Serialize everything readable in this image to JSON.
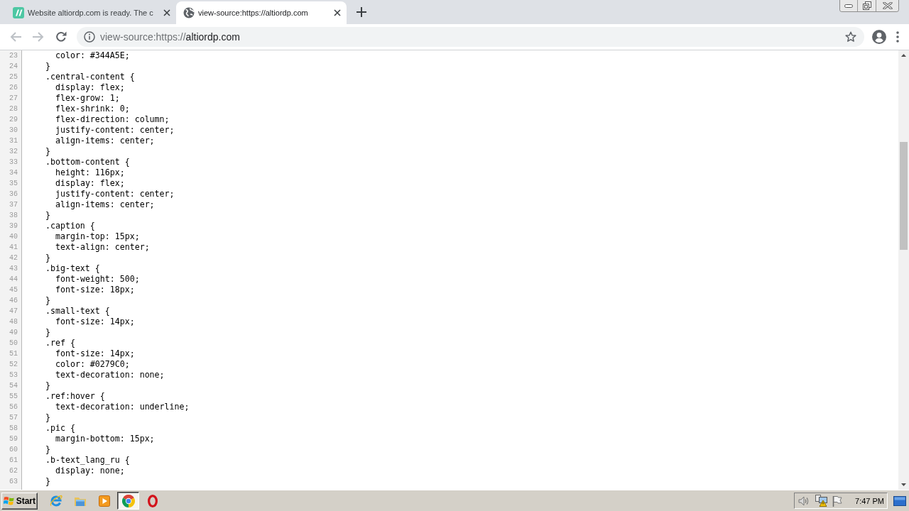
{
  "tabs": [
    {
      "kind": "logo",
      "title": "Website altiordp.com is ready. The c",
      "selected": false
    },
    {
      "kind": "globe",
      "title": "view-source:https://altiordp.com",
      "selected": true
    }
  ],
  "toolbar": {
    "nav_buttons": [
      {
        "kind": "back",
        "disabled": true
      },
      {
        "kind": "forward",
        "disabled": true
      },
      {
        "kind": "reload",
        "disabled": false
      }
    ],
    "address": {
      "scheme": "view-source:https://",
      "host": "altiordp.com"
    }
  },
  "source": {
    "lines": [
      {
        "number": "23",
        "kind": "declaration",
        "text": "color: #344A5E;"
      },
      {
        "number": "24",
        "kind": "brace",
        "text": "}"
      },
      {
        "number": "25",
        "kind": "selector",
        "text": ".central-content {"
      },
      {
        "number": "26",
        "kind": "declaration",
        "text": "display: flex;"
      },
      {
        "number": "27",
        "kind": "declaration",
        "text": "flex-grow: 1;"
      },
      {
        "number": "28",
        "kind": "declaration",
        "text": "flex-shrink: 0;"
      },
      {
        "number": "29",
        "kind": "declaration",
        "text": "flex-direction: column;"
      },
      {
        "number": "30",
        "kind": "declaration",
        "text": "justify-content: center;"
      },
      {
        "number": "31",
        "kind": "declaration",
        "text": "align-items: center;"
      },
      {
        "number": "32",
        "kind": "brace",
        "text": "}"
      },
      {
        "number": "33",
        "kind": "selector",
        "text": ".bottom-content {"
      },
      {
        "number": "34",
        "kind": "declaration",
        "text": "height: 116px;"
      },
      {
        "number": "35",
        "kind": "declaration",
        "text": "display: flex;"
      },
      {
        "number": "36",
        "kind": "declaration",
        "text": "justify-content: center;"
      },
      {
        "number": "37",
        "kind": "declaration",
        "text": "align-items: center;"
      },
      {
        "number": "38",
        "kind": "brace",
        "text": "}"
      },
      {
        "number": "39",
        "kind": "selector",
        "text": ".caption {"
      },
      {
        "number": "40",
        "kind": "declaration",
        "text": "margin-top: 15px;"
      },
      {
        "number": "41",
        "kind": "declaration",
        "text": "text-align: center;"
      },
      {
        "number": "42",
        "kind": "brace",
        "text": "}"
      },
      {
        "number": "43",
        "kind": "selector",
        "text": ".big-text {"
      },
      {
        "number": "44",
        "kind": "declaration",
        "text": "font-weight: 500;"
      },
      {
        "number": "45",
        "kind": "declaration",
        "text": "font-size: 18px;"
      },
      {
        "number": "46",
        "kind": "brace",
        "text": "}"
      },
      {
        "number": "47",
        "kind": "selector",
        "text": ".small-text {"
      },
      {
        "number": "48",
        "kind": "declaration",
        "text": "font-size: 14px;"
      },
      {
        "number": "49",
        "kind": "brace",
        "text": "}"
      },
      {
        "number": "50",
        "kind": "selector",
        "text": ".ref {"
      },
      {
        "number": "51",
        "kind": "declaration",
        "text": "font-size: 14px;"
      },
      {
        "number": "52",
        "kind": "declaration",
        "text": "color: #0279C0;"
      },
      {
        "number": "53",
        "kind": "declaration",
        "text": "text-decoration: none;"
      },
      {
        "number": "54",
        "kind": "brace",
        "text": "}"
      },
      {
        "number": "55",
        "kind": "selector",
        "text": ".ref:hover {"
      },
      {
        "number": "56",
        "kind": "declaration",
        "text": "text-decoration: underline;"
      },
      {
        "number": "57",
        "kind": "brace",
        "text": "}"
      },
      {
        "number": "58",
        "kind": "selector",
        "text": ".pic {"
      },
      {
        "number": "59",
        "kind": "declaration",
        "text": "margin-bottom: 15px;"
      },
      {
        "number": "60",
        "kind": "brace",
        "text": "}"
      },
      {
        "number": "61",
        "kind": "selector",
        "text": ".b-text_lang_ru {"
      },
      {
        "number": "62",
        "kind": "declaration",
        "text": "display: none;"
      },
      {
        "number": "63",
        "kind": "brace",
        "text": "}"
      }
    ]
  },
  "taskbar": {
    "start_label": "Start",
    "items": [
      {
        "kind": "e_logo",
        "selected": false
      },
      {
        "kind": "folder",
        "selected": false
      },
      {
        "kind": "player",
        "selected": false
      },
      {
        "kind": "ring_logo",
        "selected": true
      },
      {
        "kind": "o_logo",
        "selected": false
      }
    ],
    "clock": "7:47 PM"
  }
}
